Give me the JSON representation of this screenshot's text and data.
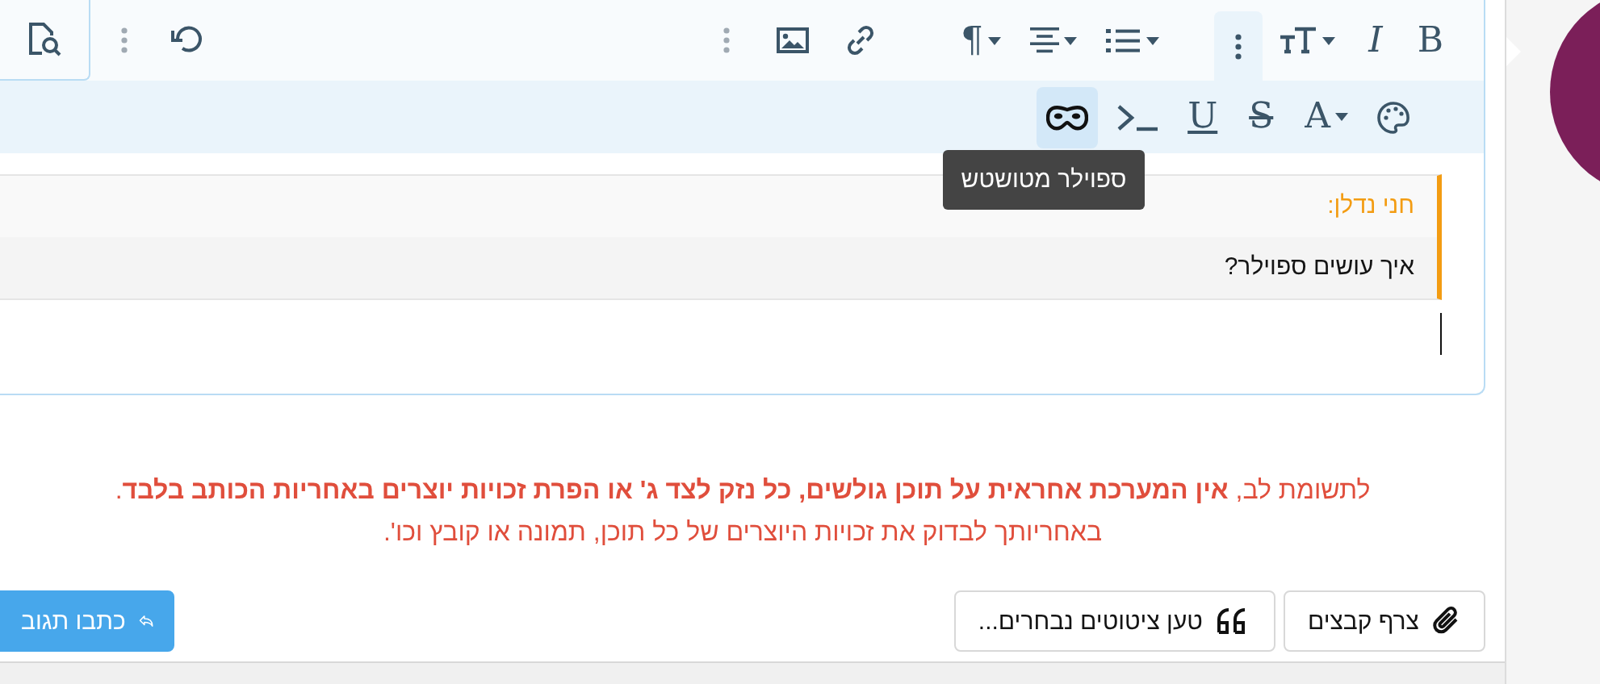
{
  "toolbar": {
    "groups": [
      [
        {
          "label": "B",
          "selected": false
        },
        {
          "label": "I",
          "selected": false
        },
        {
          "dropdown": true,
          "selected": false
        },
        {
          "selected": true
        }
      ],
      [
        {
          "dropdown": true,
          "selected": false
        },
        {
          "dropdown": true,
          "selected": false
        },
        {
          "label": "¶",
          "dropdown": true,
          "selected": false
        }
      ],
      [
        {
          "selected": false
        },
        {
          "selected": false
        },
        {
          "selected": false
        }
      ],
      [
        {
          "selected": false
        },
        {
          "selected": false
        }
      ]
    ],
    "row2": [
      {
        "selected": false
      },
      {
        "label": "A",
        "dropdown": true,
        "selected": false
      },
      {
        "label": "S",
        "selected": false
      },
      {
        "label": "U",
        "selected": false
      },
      {
        "selected": false
      },
      {
        "selected": true
      }
    ]
  },
  "tooltip": "ספוילר מטושטש",
  "quote": {
    "author": "חני נדלן:",
    "text": "איך עושים ספוילר?"
  },
  "notice": [
    "לתשומת לב, **אין המערכת אחראית על תוכן גולשים, כל נזק לצד ג' או הפרת זכויות יוצרים באחריות הכותב בלבד**.",
    "באחריותך לבדוק את זכויות היוצרים של כל תוכן, תמונה או קובץ וכו'."
  ],
  "buttons": {
    "attach": "צרף קבצים",
    "quotes": "טען ציטוטים נבחרים...",
    "reply": "כתבו תגוב"
  }
}
